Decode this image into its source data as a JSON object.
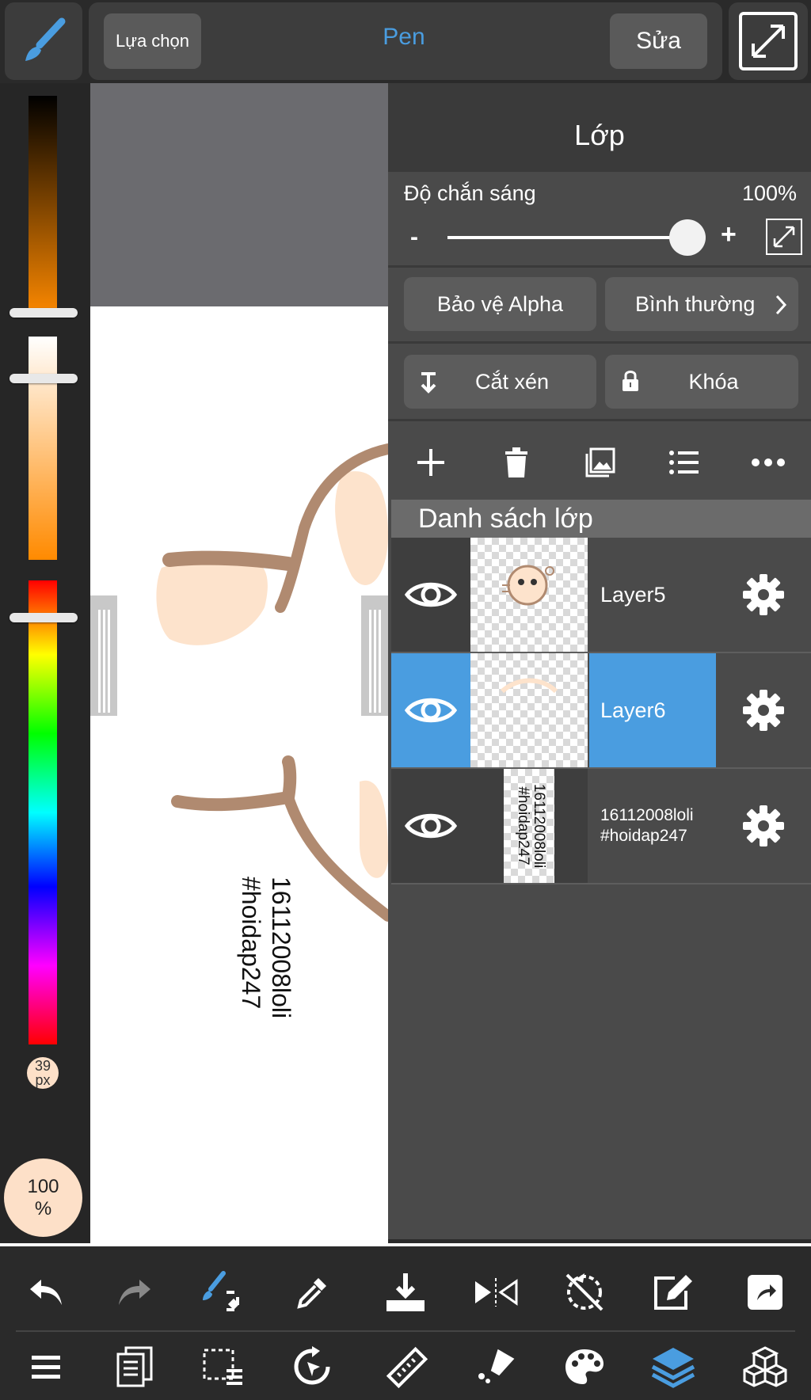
{
  "topbar": {
    "selection_label": "Lựa chọn",
    "tool_name": "Pen",
    "edit_label": "Sửa"
  },
  "leftbar": {
    "brush_size": "39 px",
    "opacity": "100 %"
  },
  "canvas": {
    "watermark_line1": "16112008loli",
    "watermark_line2": "#hoidap247"
  },
  "layers_panel": {
    "title": "Lớp",
    "opacity_label": "Độ chắn sáng",
    "opacity_value": "100%",
    "opacity_level": 1.0,
    "minus_label": "-",
    "plus_label": "+",
    "alpha_protect_label": "Bảo vệ Alpha",
    "blend_mode_label": "Bình thường",
    "clip_label": "Cắt xén",
    "lock_label": "Khóa",
    "list_header": "Danh sách lớp",
    "layers": [
      {
        "name": "Layer5",
        "selected": false
      },
      {
        "name": "Layer6",
        "selected": true
      },
      {
        "name": "16112008loli\n#hoidap247",
        "selected": false
      }
    ],
    "thumb_text_line1": "16112008loli",
    "thumb_text_line2": "#hoidap247"
  },
  "colors": {
    "accent": "#4a9de0",
    "selected_row": "#4a9de0",
    "panel_bg": "#4a4a4a",
    "toolbar_bg": "#2a2a2a"
  },
  "icons": {
    "top": [
      "brush-icon",
      "fullscreen-icon"
    ],
    "layer_actions": [
      "plus-icon",
      "trash-icon",
      "image-icon",
      "list-icon",
      "more-icon"
    ],
    "toolbar_row1": [
      "undo-icon",
      "redo-icon",
      "brush-transform-icon",
      "eyedropper-icon",
      "save-icon",
      "flip-icon",
      "rotate-off-icon",
      "edit-box-icon",
      "share-icon"
    ],
    "toolbar_row2": [
      "menu-icon",
      "pages-icon",
      "selection-icon",
      "rotate-icon",
      "ruler-icon",
      "fill-icon",
      "palette-icon",
      "layers-icon",
      "material-icon"
    ]
  }
}
